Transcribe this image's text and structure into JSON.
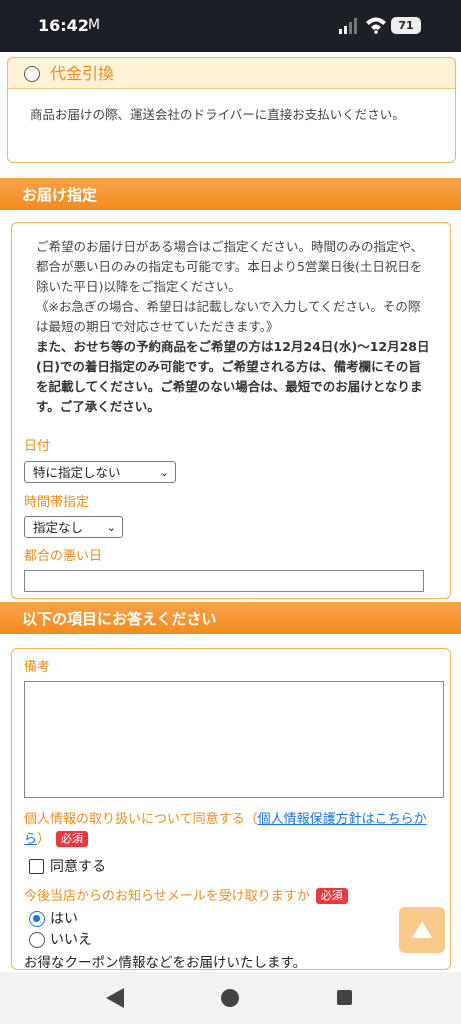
{
  "status_bar": {
    "time": "16:42",
    "mail_icon": "M",
    "battery": "71"
  },
  "payment": {
    "option_title": "代金引換",
    "description": "商品お届けの際、運送会社のドライバーに直接お支払いください。"
  },
  "delivery": {
    "section_title": "お届け指定",
    "info_line1": "ご希望のお届け日がある場合はご指定ください。時間のみの指定や、都合が悪い日のみの指定も可能です。本日より5営業日後(土日祝日を除いた平日)以降をご指定ください。",
    "info_line2": "《※お急ぎの場合、希望日は記載しないで入力してください。その際は最短の期日で対応させていただきます。》",
    "info_bold": "また、おせち等の予約商品をご希望の方は12月24日(水)〜12月28日(日)での着日指定のみ可能です。ご希望される方は、備考欄にその旨を記載してください。ご希望のない場合は、最短でのお届けとなります。ご了承ください。",
    "date_label": "日付",
    "date_value": "特に指定しない",
    "time_label": "時間帯指定",
    "time_value": "指定なし",
    "bad_day_label": "都合の悪い日",
    "bad_day_value": ""
  },
  "questions": {
    "section_title": "以下の項目にお答えください",
    "remarks_label": "備考",
    "remarks_value": "",
    "privacy_text": "個人情報の取り扱いについて同意する",
    "privacy_open": "（",
    "privacy_link": "個人情報保護方針はこちらから",
    "privacy_close": "）",
    "required": "必須",
    "agree_label": "同意する",
    "mail_question": "今後当店からのお知らせメールを受け取りますか",
    "mail_yes": "はい",
    "mail_no": "いいえ",
    "coupon_text": "お得なクーポン情報などをお届けいたします。"
  },
  "colors": {
    "accent": "#f08c1e",
    "section_bar": "#f38b1f",
    "required_badge": "#e8393f",
    "link": "#1a73e8"
  }
}
